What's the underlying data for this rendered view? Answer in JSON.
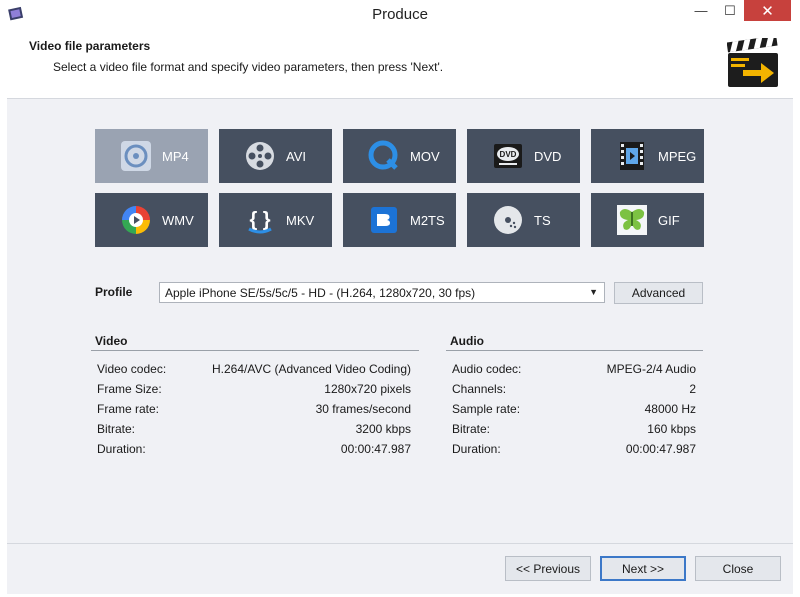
{
  "window": {
    "title": "Produce"
  },
  "header": {
    "title": "Video file parameters",
    "subtitle": "Select a video file format and specify video parameters, then press 'Next'."
  },
  "formats": [
    {
      "label": "MP4",
      "icon": "disc-icon",
      "selected": true
    },
    {
      "label": "AVI",
      "icon": "film-reel-icon"
    },
    {
      "label": "MOV",
      "icon": "quicktime-icon"
    },
    {
      "label": "DVD",
      "icon": "dvd-icon"
    },
    {
      "label": "MPEG",
      "icon": "film-strip-icon"
    },
    {
      "label": "WMV",
      "icon": "windows-media-icon"
    },
    {
      "label": "MKV",
      "icon": "braces-icon"
    },
    {
      "label": "M2TS",
      "icon": "bluray-icon"
    },
    {
      "label": "TS",
      "icon": "disc-dots-icon"
    },
    {
      "label": "GIF",
      "icon": "butterfly-icon"
    }
  ],
  "profile": {
    "label": "Profile",
    "value": "Apple iPhone SE/5s/5c/5 - HD - (H.264, 1280x720, 30 fps)",
    "advanced_label": "Advanced"
  },
  "video": {
    "title": "Video",
    "rows": [
      {
        "label": "Video codec:",
        "value": "H.264/AVC (Advanced Video Coding)"
      },
      {
        "label": "Frame Size:",
        "value": "1280x720 pixels"
      },
      {
        "label": "Frame rate:",
        "value": "30 frames/second"
      },
      {
        "label": "Bitrate:",
        "value": "3200 kbps"
      },
      {
        "label": "Duration:",
        "value": "00:00:47.987"
      }
    ]
  },
  "audio": {
    "title": "Audio",
    "rows": [
      {
        "label": "Audio codec:",
        "value": "MPEG-2/4 Audio"
      },
      {
        "label": "Channels:",
        "value": "2"
      },
      {
        "label": "Sample rate:",
        "value": "48000 Hz"
      },
      {
        "label": "Bitrate:",
        "value": "160 kbps"
      },
      {
        "label": "Duration:",
        "value": "00:00:47.987"
      }
    ]
  },
  "footer": {
    "previous": "<< Previous",
    "next": "Next >>",
    "close": "Close"
  },
  "colors": {
    "tile": "#465060",
    "tile_selected": "#9aa3b2",
    "close_button": "#c7413d",
    "focus_border": "#3c78c8"
  }
}
